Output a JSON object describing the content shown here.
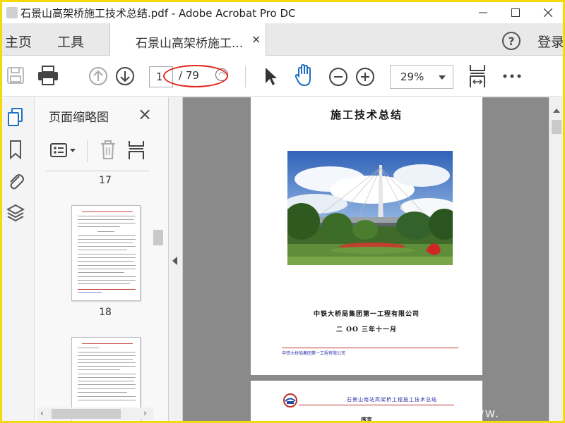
{
  "window": {
    "title": "石景山高架桥施工技术总结.pdf - Adobe Acrobat Pro DC"
  },
  "tabs": {
    "home": "主页",
    "tools": "工具",
    "document": "石景山高架桥施工...",
    "close": "×",
    "help": "?",
    "login": "登录"
  },
  "toolbar": {
    "current_page": "1",
    "total_pages": "/ 79",
    "zoom": "29%",
    "annotation_color": "#e2261c"
  },
  "thumbnails": {
    "title": "页面缩略图",
    "close": "×",
    "pages": [
      {
        "number": "17"
      },
      {
        "number": "18"
      }
    ]
  },
  "document": {
    "page1": {
      "title": "施工技术总结",
      "company": "中铁大桥局集团第一工程有限公司",
      "date": "二 OO 三年十一月",
      "footer": "中铁大桥局集团第一工程有限公司"
    },
    "page2": {
      "header": "石景山南站高架桥工程施工技术总结",
      "section": "序言"
    }
  },
  "watermark": "www.",
  "colors": {
    "accent_blue": "#1f6fc4",
    "rule_red": "#c0302a",
    "frame": "#f5d90a"
  }
}
